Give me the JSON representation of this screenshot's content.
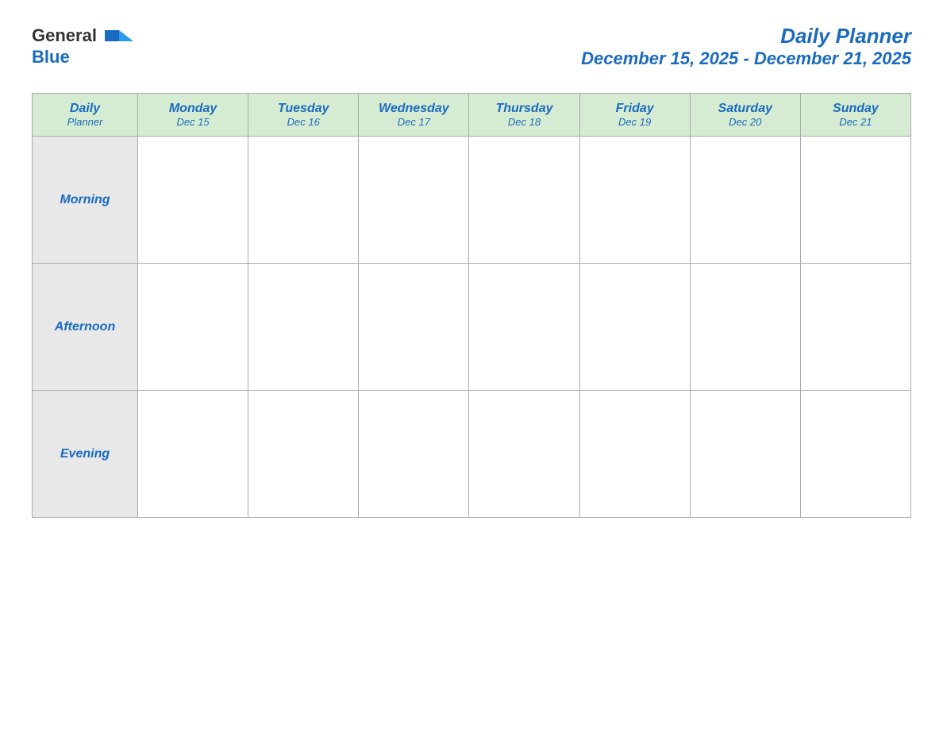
{
  "header": {
    "logo_general": "General",
    "logo_blue": "Blue",
    "title": "Daily Planner",
    "date_range": "December 15, 2025 - December 21, 2025"
  },
  "table": {
    "header_label": "Daily",
    "header_label2": "Planner",
    "columns": [
      {
        "day": "Monday",
        "date": "Dec 15"
      },
      {
        "day": "Tuesday",
        "date": "Dec 16"
      },
      {
        "day": "Wednesday",
        "date": "Dec 17"
      },
      {
        "day": "Thursday",
        "date": "Dec 18"
      },
      {
        "day": "Friday",
        "date": "Dec 19"
      },
      {
        "day": "Saturday",
        "date": "Dec 20"
      },
      {
        "day": "Sunday",
        "date": "Dec 21"
      }
    ],
    "rows": [
      {
        "label": "Morning"
      },
      {
        "label": "Afternoon"
      },
      {
        "label": "Evening"
      }
    ]
  }
}
